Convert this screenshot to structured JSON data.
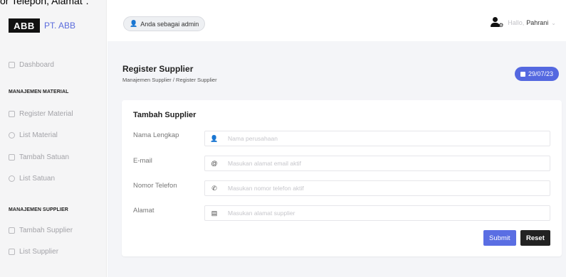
{
  "overflow_text": "or Telepon, Alamat\".",
  "sidebar": {
    "brand_logo": "ABB",
    "brand_name": "PT. ABB",
    "dashboard": "Dashboard",
    "section_material": "MANAJEMEN MATERIAL",
    "register_material": "Register Material",
    "list_material": "List Material",
    "tambah_satuan": "Tambah Satuan",
    "list_satuan": "List Satuan",
    "section_supplier": "MANAJEMEN SUPPLIER",
    "tambah_supplier": "Tambah Supplier",
    "list_supplier": "List Supplier"
  },
  "topbar": {
    "admin_badge": "Anda sebagai admin",
    "greeting": "Hallo,",
    "username": "Pahrani"
  },
  "page": {
    "title": "Register Supplier",
    "breadcrumb": "Manajemen Supplier / Register Supplier",
    "date": "29/07/23"
  },
  "form": {
    "title": "Tambah Supplier",
    "nama_label": "Nama Lengkap",
    "nama_placeholder": "Nama perusahaan",
    "email_label": "E-mail",
    "email_placeholder": "Masukan alamat email aktif",
    "telefon_label": "Nomor Telefon",
    "telefon_placeholder": "Masukan nomor telefon aktif",
    "alamat_label": "Alamat",
    "alamat_placeholder": "Masukan alamat supplier",
    "submit_label": "Submit",
    "reset_label": "Reset"
  },
  "colors": {
    "accent": "#5468e0",
    "dark_button": "#222222",
    "sidebar_bg": "#f5f5f6"
  }
}
